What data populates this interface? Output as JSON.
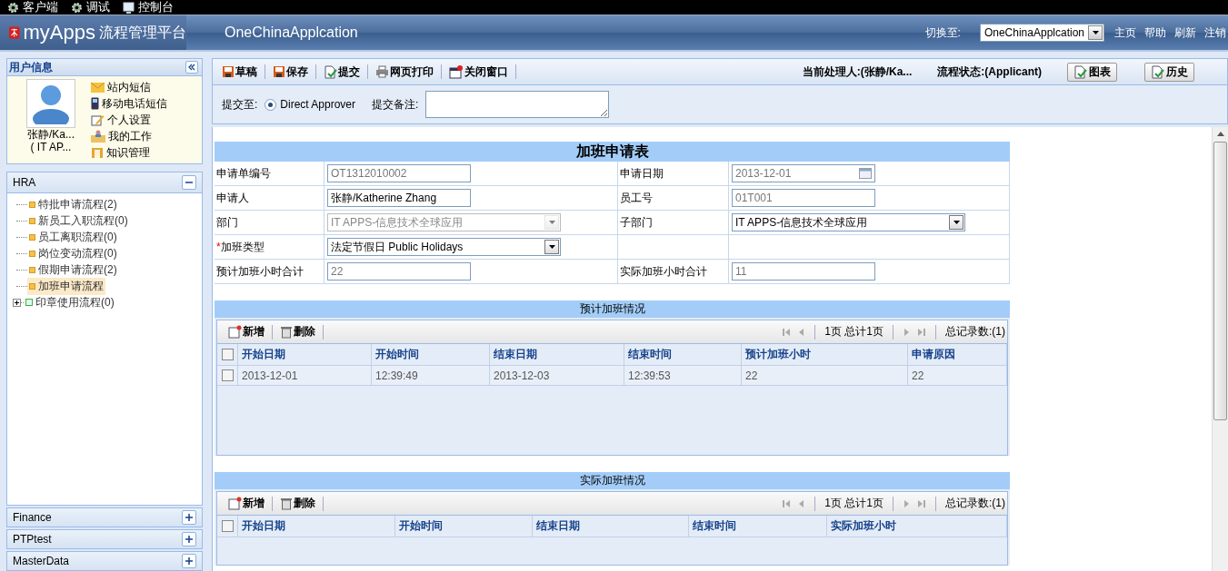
{
  "top_bar": {
    "items": [
      {
        "label": "客户端",
        "kind": "gear"
      },
      {
        "label": "调试",
        "kind": "gear"
      },
      {
        "label": "控制台",
        "kind": "monitor"
      }
    ]
  },
  "header": {
    "logo_text": "myApps",
    "platform": "流程管理平台",
    "app_title": "OneChinaApplcation",
    "switch_label": "切换至:",
    "switch_value": "OneChinaApplcation",
    "links": [
      "主页",
      "帮助",
      "刷新",
      "注销"
    ]
  },
  "user_panel": {
    "title": "用户信息",
    "name": "张静/Ka...",
    "dept": "( IT AP...",
    "links": [
      {
        "label": "站内短信",
        "kind": "mail"
      },
      {
        "label": "移动电话短信",
        "kind": "phone"
      },
      {
        "label": "个人设置",
        "kind": "edit"
      },
      {
        "label": "我的工作",
        "kind": "work"
      },
      {
        "label": "知识管理",
        "kind": "knowledge"
      }
    ]
  },
  "sidebar": {
    "groups": [
      {
        "title": "HRA",
        "expanded": true,
        "items": [
          {
            "label": "特批申请流程(2)",
            "kind": "leaf",
            "selected": false
          },
          {
            "label": "新员工入职流程(0)",
            "kind": "leaf",
            "selected": false
          },
          {
            "label": "员工离职流程(0)",
            "kind": "leaf",
            "selected": false
          },
          {
            "label": "岗位变动流程(0)",
            "kind": "leaf",
            "selected": false
          },
          {
            "label": "假期申请流程(2)",
            "kind": "leaf",
            "selected": false
          },
          {
            "label": "加班申请流程",
            "kind": "leaf",
            "selected": true
          },
          {
            "label": "印章使用流程(0)",
            "kind": "folder",
            "selected": false
          }
        ]
      },
      {
        "title": "Finance",
        "expanded": false
      },
      {
        "title": "PTPtest",
        "expanded": false
      },
      {
        "title": "MasterData",
        "expanded": false
      }
    ]
  },
  "toolbar": {
    "buttons": [
      {
        "label": "草稿",
        "kind": "save"
      },
      {
        "label": "保存",
        "kind": "save"
      },
      {
        "label": "提交",
        "kind": "submit"
      },
      {
        "label": "网页打印",
        "kind": "print"
      },
      {
        "label": "关闭窗口",
        "kind": "close"
      }
    ],
    "handler": "当前处理人:(张静/Ka...",
    "status": "流程状态:(Applicant)",
    "right_buttons": [
      "图表",
      "历史"
    ]
  },
  "submit": {
    "label": "提交至:",
    "options": [
      {
        "label": "Direct Approver",
        "selected": true
      }
    ],
    "remark_label": "提交备注:"
  },
  "form": {
    "title": "加班申请表",
    "required_mark": "*",
    "rows": [
      [
        {
          "label": "申请单编号",
          "value": "OT1312010002",
          "kind": "text",
          "disabled": true,
          "required": false
        },
        {
          "label": "申请日期",
          "value": "2013-12-01",
          "kind": "date",
          "disabled": true,
          "required": false
        }
      ],
      [
        {
          "label": "申请人",
          "value": "张静/Katherine Zhang",
          "kind": "text",
          "disabled": false,
          "required": false
        },
        {
          "label": "员工号",
          "value": "01T001",
          "kind": "text",
          "disabled": true,
          "required": false
        }
      ],
      [
        {
          "label": "部门",
          "value": "IT APPS-信息技术全球应用",
          "kind": "select",
          "disabled": true,
          "required": false
        },
        {
          "label": "子部门",
          "value": "IT APPS-信息技术全球应用",
          "kind": "select",
          "disabled": false,
          "required": false
        }
      ],
      [
        {
          "label": "加班类型",
          "value": "法定节假日 Public Holidays",
          "kind": "select",
          "disabled": false,
          "required": true
        }
      ],
      [
        {
          "label": "预计加班小时合计",
          "value": "22",
          "kind": "text",
          "disabled": true,
          "required": false
        },
        {
          "label": "实际加班小时合计",
          "value": "11",
          "kind": "text",
          "disabled": true,
          "required": false
        }
      ]
    ]
  },
  "grids": [
    {
      "title": "预计加班情况",
      "select_all_checked": false,
      "actions": [
        "新增",
        "删除"
      ],
      "page_info": "1页 总计1页",
      "total": "总记录数:(1)",
      "columns": [
        "开始日期",
        "开始时间",
        "结束日期",
        "结束时间",
        "预计加班小时",
        "申请原因"
      ],
      "rows": [
        {
          "checked": false,
          "cells": [
            "2013-12-01",
            "12:39:49",
            "2013-12-03",
            "12:39:53",
            "22",
            "22"
          ]
        }
      ]
    },
    {
      "title": "实际加班情况",
      "select_all_checked": false,
      "actions": [
        "新增",
        "删除"
      ],
      "page_info": "1页 总计1页",
      "total": "总记录数:(1)",
      "columns": [
        "开始日期",
        "开始时间",
        "结束日期",
        "结束时间",
        "实际加班小时"
      ]
    }
  ]
}
